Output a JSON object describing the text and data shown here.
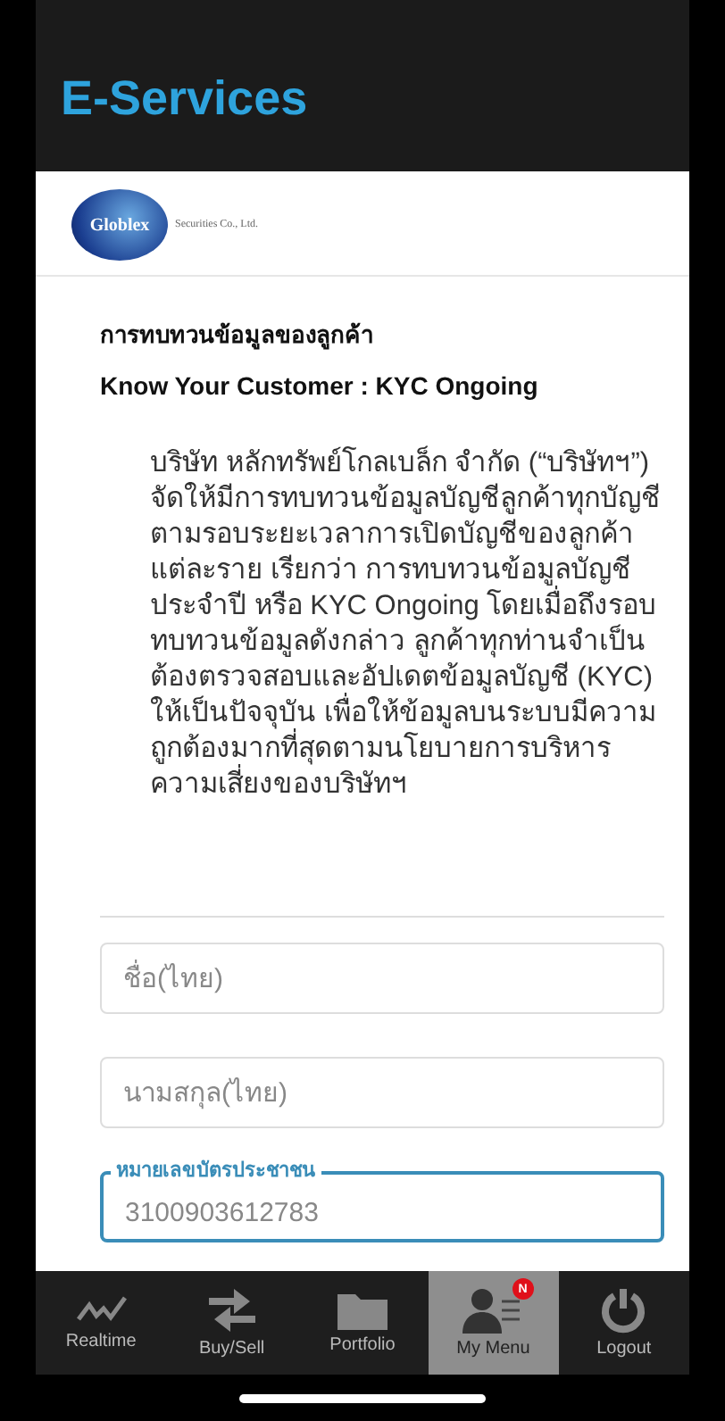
{
  "header": {
    "title": "E-Services"
  },
  "logo": {
    "brand": "Globlex",
    "tagline": "Securities Co., Ltd."
  },
  "heading": {
    "thai": "การทบทวนข้อมูลของลูกค้า",
    "english": "Know Your Customer : KYC Ongoing"
  },
  "paragraph": "บริษัท หลักทรัพย์โกลเบล็ก จำกัด (“บริษัทฯ”) จัดให้มีการทบทวนข้อมูลบัญชีลูกค้าทุกบัญชี ตามรอบระยะเวลาการเปิดบัญชีของลูกค้า แต่ละราย เรียกว่า การทบทวนข้อมูลบัญชี ประจำปี หรือ KYC Ongoing โดยเมื่อถึงรอบ ทบทวนข้อมูลดังกล่าว ลูกค้าทุกท่านจำเป็น ต้องตรวจสอบและอัปเดตข้อมูลบัญชี (KYC) ให้เป็นปัจจุบัน เพื่อให้ข้อมูลบนระบบมีความ ถูกต้องมากที่สุดตามนโยบายการบริหาร ความเสี่ยงของบริษัทฯ",
  "fields": [
    {
      "placeholder": "ชื่อ(ไทย)",
      "focused": false
    },
    {
      "placeholder": "นามสกุล(ไทย)",
      "focused": false
    },
    {
      "label": "หมายเลขบัตรประชาชน",
      "value": "3100903612783",
      "focused": true
    }
  ],
  "tabs": [
    {
      "kind": "realtime",
      "label": "Realtime",
      "selected": false
    },
    {
      "kind": "buysell",
      "label": "Buy/Sell",
      "selected": false
    },
    {
      "kind": "portfolio",
      "label": "Portfolio",
      "selected": false
    },
    {
      "kind": "menu",
      "label": "My Menu",
      "selected": true,
      "badge": "N"
    },
    {
      "kind": "logout",
      "label": "Logout",
      "selected": false
    }
  ]
}
